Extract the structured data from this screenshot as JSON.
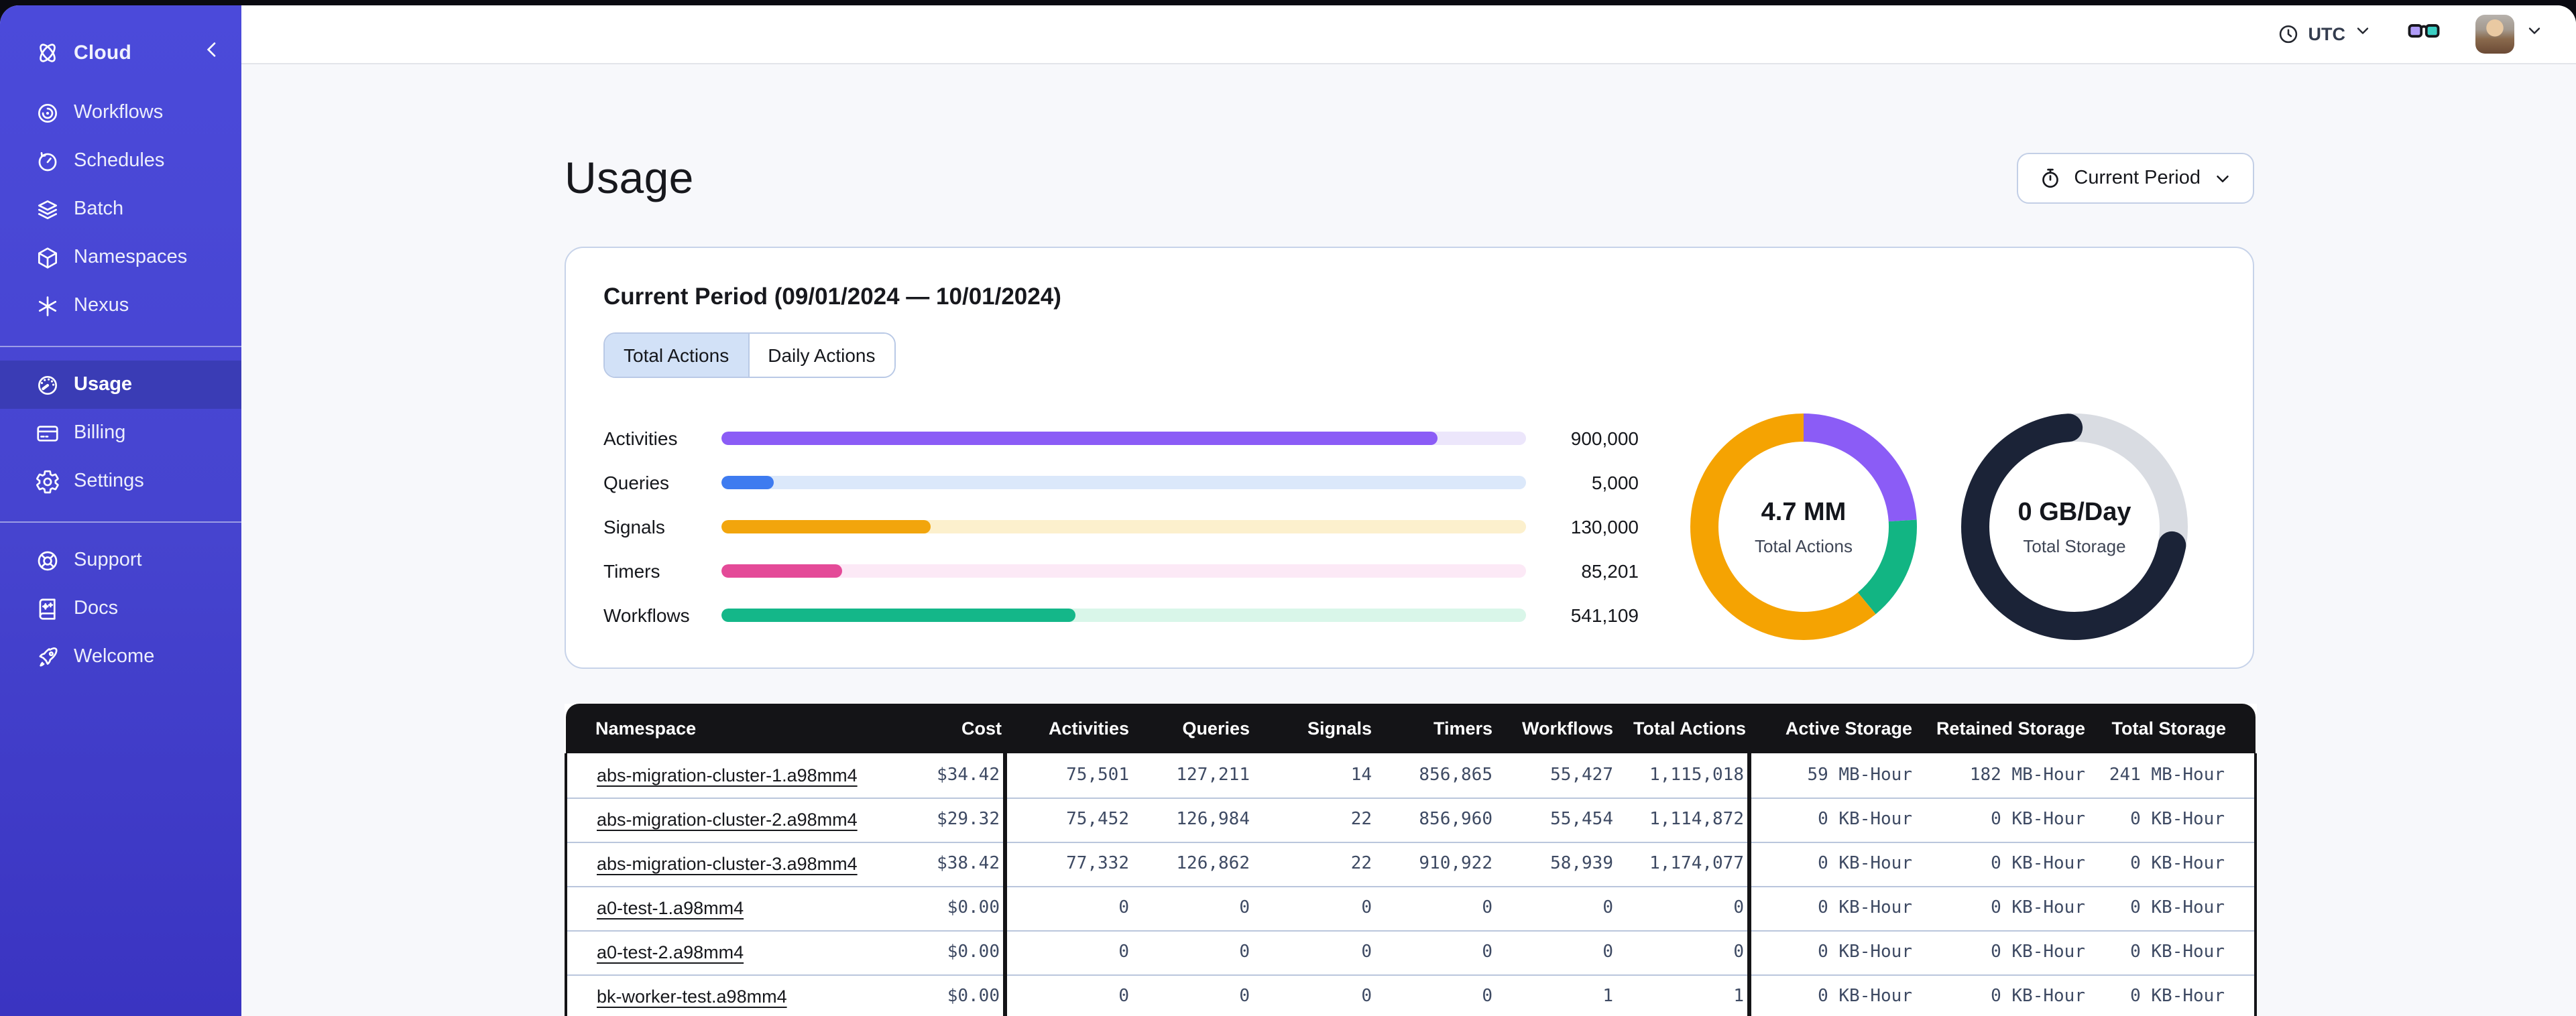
{
  "topbar": {
    "timezone": "UTC"
  },
  "sidebar": {
    "header": {
      "label": "Cloud"
    },
    "groups": [
      {
        "items": [
          {
            "label": "Workflows"
          },
          {
            "label": "Schedules"
          },
          {
            "label": "Batch"
          },
          {
            "label": "Namespaces"
          },
          {
            "label": "Nexus"
          }
        ]
      },
      {
        "items": [
          {
            "label": "Usage"
          },
          {
            "label": "Billing"
          },
          {
            "label": "Settings"
          }
        ]
      },
      {
        "items": [
          {
            "label": "Support"
          },
          {
            "label": "Docs"
          },
          {
            "label": "Welcome"
          }
        ]
      }
    ]
  },
  "page": {
    "title": "Usage",
    "period_button": {
      "label": "Current Period"
    }
  },
  "card": {
    "heading": "Current Period (09/01/2024 — 10/01/2024)",
    "tabs": [
      {
        "label": "Total Actions"
      },
      {
        "label": "Daily Actions"
      }
    ],
    "bars": [
      {
        "label": "Activities",
        "value": "900,000",
        "pct": "89%",
        "fill": "#8b5cf6",
        "track": "#ece6fb"
      },
      {
        "label": "Queries",
        "value": "5,000",
        "pct": "6.5%",
        "fill": "#3e7bf0",
        "track": "#dbe8fa"
      },
      {
        "label": "Signals",
        "value": "130,000",
        "pct": "26%",
        "fill": "#f2a50c",
        "track": "#fcf0cd"
      },
      {
        "label": "Timers",
        "value": "85,201",
        "pct": "15%",
        "fill": "#e44a98",
        "track": "#fce9f6"
      },
      {
        "label": "Workflows",
        "value": "541,109",
        "pct": "44%",
        "fill": "#14b789",
        "track": "#d9f6e9"
      }
    ],
    "donuts": [
      {
        "value": "4.7 MM",
        "label": "Total Actions",
        "linecap": "butt",
        "track": "",
        "segments": [
          {
            "color": "#8b5cf6",
            "start": 0,
            "pct": 24
          },
          {
            "color": "#12b583",
            "start": 24,
            "pct": 15
          },
          {
            "color": "#f5a302",
            "start": 39,
            "pct": 61
          }
        ]
      },
      {
        "value": "0 GB/Day",
        "label": "Total Storage",
        "linecap": "round",
        "track": "#d9dce2",
        "segments": [
          {
            "color": "#1b2337",
            "start": 28,
            "pct": 71
          }
        ]
      }
    ]
  },
  "table": {
    "columns": [
      "Namespace",
      "Cost",
      "Activities",
      "Queries",
      "Signals",
      "Timers",
      "Workflows",
      "Total Actions",
      "Active Storage",
      "Retained Storage",
      "Total Storage"
    ],
    "rows": [
      [
        "abs-migration-cluster-1.a98mm4",
        "$34.42",
        "75,501",
        "127,211",
        "14",
        "856,865",
        "55,427",
        "1,115,018",
        "59 MB-Hour",
        "182 MB-Hour",
        "241 MB-Hour"
      ],
      [
        "abs-migration-cluster-2.a98mm4",
        "$29.32",
        "75,452",
        "126,984",
        "22",
        "856,960",
        "55,454",
        "1,114,872",
        "0 KB-Hour",
        "0 KB-Hour",
        "0 KB-Hour"
      ],
      [
        "abs-migration-cluster-3.a98mm4",
        "$38.42",
        "77,332",
        "126,862",
        "22",
        "910,922",
        "58,939",
        "1,174,077",
        "0 KB-Hour",
        "0 KB-Hour",
        "0 KB-Hour"
      ],
      [
        "a0-test-1.a98mm4",
        "$0.00",
        "0",
        "0",
        "0",
        "0",
        "0",
        "0",
        "0 KB-Hour",
        "0 KB-Hour",
        "0 KB-Hour"
      ],
      [
        "a0-test-2.a98mm4",
        "$0.00",
        "0",
        "0",
        "0",
        "0",
        "0",
        "0",
        "0 KB-Hour",
        "0 KB-Hour",
        "0 KB-Hour"
      ],
      [
        "bk-worker-test.a98mm4",
        "$0.00",
        "0",
        "0",
        "0",
        "0",
        "1",
        "1",
        "0 KB-Hour",
        "0 KB-Hour",
        "0 KB-Hour"
      ]
    ]
  }
}
